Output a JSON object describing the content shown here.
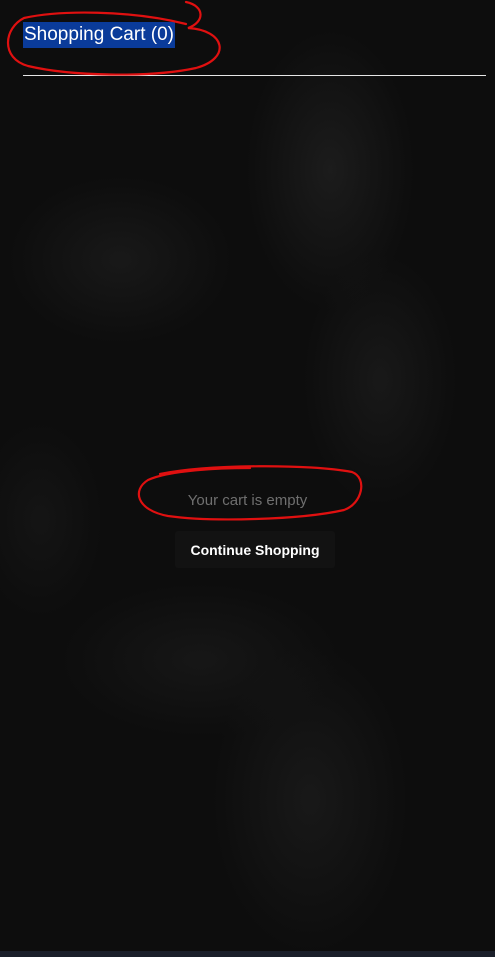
{
  "cart": {
    "title": "Shopping Cart (0)",
    "empty_message": "Your cart is empty",
    "continue_label": "Continue Shopping"
  },
  "colors": {
    "background": "#0d0d0d",
    "title_highlight": "#0a3b9a",
    "annotation_red": "#e01010",
    "muted_text": "#6f6f6f",
    "button_bg": "#121212"
  }
}
